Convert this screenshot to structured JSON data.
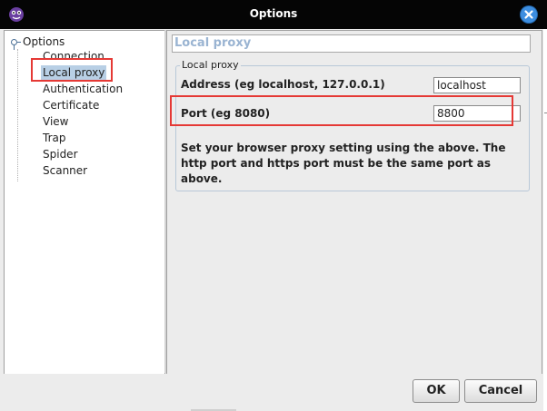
{
  "window": {
    "title": "Options",
    "app_icon": "zap-proxy-icon",
    "close_icon": "close-icon"
  },
  "tree": {
    "root_label": "Options",
    "items": [
      {
        "label": "Connection",
        "selected": false
      },
      {
        "label": "Local proxy",
        "selected": true
      },
      {
        "label": "Authentication",
        "selected": false
      },
      {
        "label": "Certificate",
        "selected": false
      },
      {
        "label": "View",
        "selected": false
      },
      {
        "label": "Trap",
        "selected": false
      },
      {
        "label": "Spider",
        "selected": false
      },
      {
        "label": "Scanner",
        "selected": false
      }
    ]
  },
  "panel": {
    "header": "Local proxy",
    "group_title": "Local proxy",
    "address_label": "Address (eg localhost, 127.0.0.1)",
    "address_value": "localhost",
    "port_label": "Port (eg 8080)",
    "port_value": "8800",
    "help_text": "Set your browser proxy setting using the above. The http port and https port must be the same port as above."
  },
  "buttons": {
    "ok_label": "OK",
    "cancel_label": "Cancel"
  },
  "colors": {
    "title_bar": "#050505",
    "close_button": "#3d8ee0",
    "selection": "#b8cfe5",
    "highlight_annotation": "#e53935",
    "panel_header_text": "#9ab4d2"
  }
}
